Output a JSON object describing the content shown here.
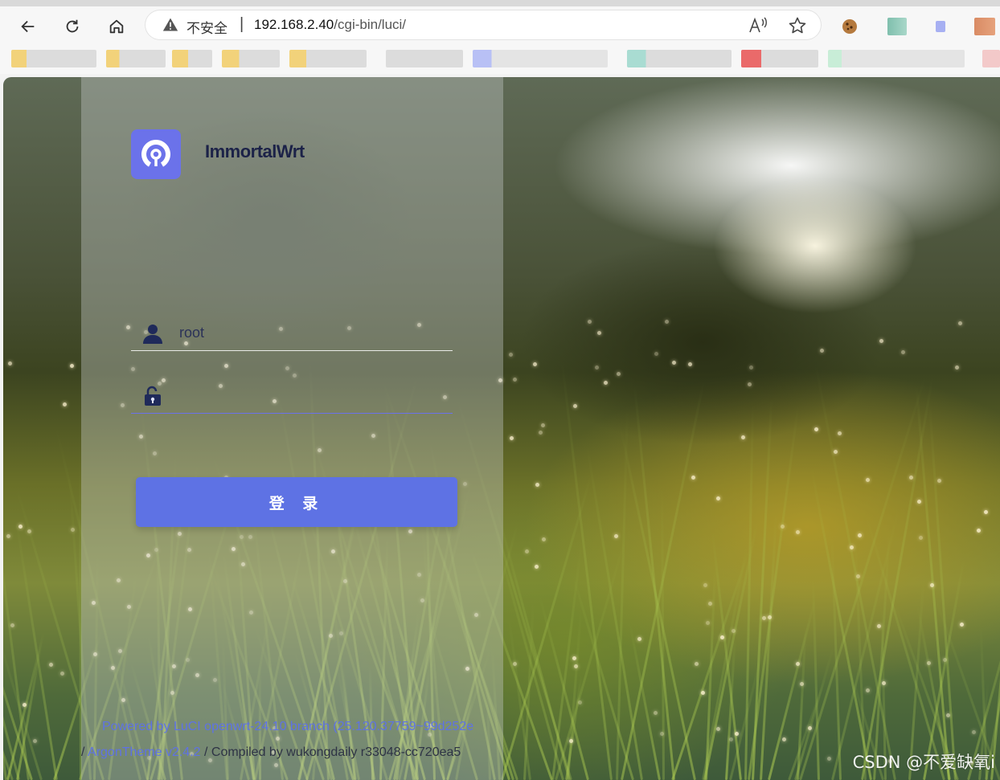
{
  "browser": {
    "security_label": "不安全",
    "separator": "|",
    "url_host": "192.168.2.40",
    "url_path": "/cgi-bin/luci/"
  },
  "login": {
    "brand_name": "ImmortalWrt",
    "username_value": "root",
    "password_value": "",
    "login_button_label": "登 录"
  },
  "footer": {
    "powered_by": "Powered by LuCI openwrt-24.10 branch (25.120.37759~99d252e",
    "prefix": "/ ",
    "theme_link": "ArgonTheme v2.4.2",
    "compiled_by": " / Compiled by wukongdaily r33048-cc720ea5"
  },
  "watermark": "CSDN @不爱缺氧i",
  "colors": {
    "accent": "#5e72e4",
    "logo_bg": "#6b72ea"
  }
}
